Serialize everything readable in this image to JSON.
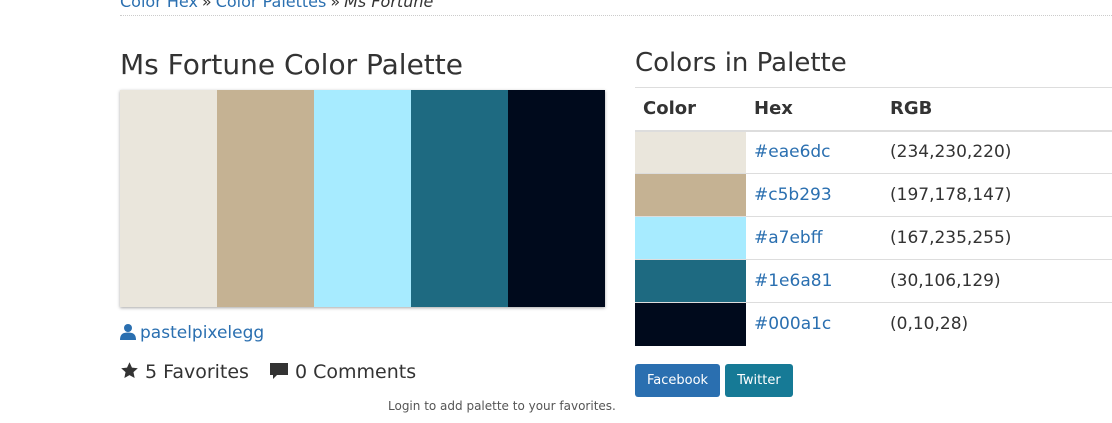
{
  "breadcrumb": {
    "items": [
      "Color Hex",
      "Color Palettes"
    ],
    "separator": "»",
    "current": "Ms Fortune"
  },
  "palette": {
    "title": "Ms Fortune Color Palette",
    "swatches": [
      "#eae6dc",
      "#c5b293",
      "#a7ebff",
      "#1e6a81",
      "#000a1c"
    ]
  },
  "author": {
    "icon": "user-icon",
    "name": "pastelpixelegg"
  },
  "stats": {
    "favorites": {
      "icon": "star-icon",
      "label": "5 Favorites"
    },
    "comments": {
      "icon": "comment-icon",
      "label": "0 Comments"
    }
  },
  "login_note": "Login to add palette to your favorites.",
  "colors_section": {
    "title": "Colors in Palette",
    "headers": {
      "color": "Color",
      "hex": "Hex",
      "rgb": "RGB"
    },
    "rows": [
      {
        "color": "#eae6dc",
        "hex": "#eae6dc",
        "rgb": "(234,230,220)"
      },
      {
        "color": "#c5b293",
        "hex": "#c5b293",
        "rgb": "(197,178,147)"
      },
      {
        "color": "#a7ebff",
        "hex": "#a7ebff",
        "rgb": "(167,235,255)"
      },
      {
        "color": "#1e6a81",
        "hex": "#1e6a81",
        "rgb": "(30,106,129)"
      },
      {
        "color": "#000a1c",
        "hex": "#000a1c",
        "rgb": "(0,10,28)"
      }
    ]
  },
  "share": {
    "facebook": {
      "label": "Facebook",
      "color": "#2a6fb0"
    },
    "twitter": {
      "label": "Twitter",
      "color": "#167a96"
    }
  },
  "colors": {
    "link": "#2a6fb0",
    "text": "#333333"
  }
}
